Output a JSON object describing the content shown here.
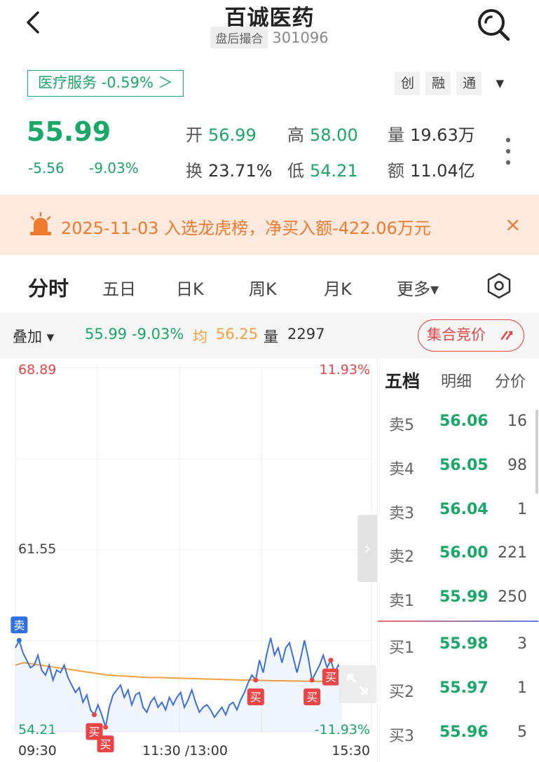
{
  "header": {
    "title": "百诚医药",
    "status": "盘后撮合",
    "code": "301096"
  },
  "sector": {
    "label": "医疗服务 -0.59% ＞"
  },
  "tags": [
    "创",
    "融",
    "通"
  ],
  "quote": {
    "price": "55.99",
    "change": "-5.56",
    "change_pct": "-9.03%",
    "open_label": "开",
    "open": "56.99",
    "high_label": "高",
    "high": "58.00",
    "volume_label": "量",
    "volume": "19.63万",
    "turnover_label": "换",
    "turnover": "23.71%",
    "low_label": "低",
    "low": "54.21",
    "amount_label": "额",
    "amount": "11.04亿"
  },
  "banner": {
    "text": "2025-11-03 入选龙虎榜，净买入额-422.06万元",
    "close": "×"
  },
  "tabs": {
    "items": [
      "分时",
      "五日",
      "日K",
      "周K",
      "月K",
      "更多▾"
    ]
  },
  "overlay": {
    "label": "叠加 ▾",
    "price": "55.99",
    "pct": "-9.03%",
    "avg_label": "均",
    "avg": "56.25",
    "vol_label": "量",
    "vol": "2297",
    "auction": "集合竞价"
  },
  "chart_data": {
    "type": "line",
    "y_top_left": "68.89",
    "y_mid_left": "61.55",
    "y_bottom_left": "54.21",
    "y_top_right": "11.93%",
    "y_bottom_right": "-11.93%",
    "x_labels": [
      "09:30",
      "11:30 /13:00",
      "15:30"
    ],
    "ylim": [
      54.21,
      68.89
    ],
    "series": [
      {
        "values": [
          57.6,
          57.9,
          57.4,
          57.1,
          56.8,
          56.9,
          57.3,
          56.7,
          56.5,
          56.9,
          56.3,
          56.7,
          56.6,
          56.9,
          56.4,
          56.1,
          55.8,
          56.0,
          55.4,
          55.7,
          55.1,
          54.9,
          55.3,
          54.9,
          54.4,
          55.2,
          55.7,
          55.9,
          56.1,
          55.6,
          55.9,
          55.3,
          55.7,
          55.8,
          55.2,
          55.0,
          55.4,
          55.6,
          55.2,
          55.4,
          55.1,
          55.6,
          55.3,
          55.6,
          55.8,
          55.2,
          55.5,
          55.9,
          55.4,
          55.0,
          55.2,
          55.3,
          55.1,
          54.8,
          55.0,
          55.2,
          54.9,
          55.3,
          55.4,
          55.1,
          55.5,
          55.8,
          56.2,
          56.5,
          56.3,
          57.1,
          56.6,
          57.4,
          58.0,
          57.3,
          57.6,
          57.0,
          57.6,
          57.8,
          57.2,
          56.6,
          57.2,
          57.9,
          57.2,
          56.3,
          56.6,
          56.9,
          57.3,
          56.8,
          57.1,
          56.6,
          56.9,
          56.5
        ]
      },
      {
        "values": [
          56.9,
          57.0,
          56.95,
          56.9,
          56.85,
          56.8,
          56.75,
          56.7,
          56.65,
          56.6,
          56.55,
          56.5,
          56.48,
          56.46,
          56.44,
          56.42,
          56.4,
          56.4,
          56.39,
          56.38,
          56.37,
          56.36,
          56.35,
          56.34,
          56.33,
          56.32,
          56.31,
          56.3,
          56.3,
          56.29,
          56.28,
          56.27,
          56.27,
          56.26,
          56.26,
          56.25,
          56.25,
          56.25,
          56.25,
          56.25
        ]
      }
    ],
    "sell_markers": [
      "卖"
    ],
    "buy_markers": [
      "买",
      "买",
      "买",
      "买",
      "买"
    ]
  },
  "orderbook": {
    "tabs": [
      "五档",
      "明细",
      "分价"
    ],
    "asks": [
      {
        "label": "卖5",
        "price": "56.06",
        "vol": "16"
      },
      {
        "label": "卖4",
        "price": "56.05",
        "vol": "98"
      },
      {
        "label": "卖3",
        "price": "56.04",
        "vol": "1"
      },
      {
        "label": "卖2",
        "price": "56.00",
        "vol": "221"
      },
      {
        "label": "卖1",
        "price": "55.99",
        "vol": "250"
      }
    ],
    "bids": [
      {
        "label": "买1",
        "price": "55.98",
        "vol": "3"
      },
      {
        "label": "买2",
        "price": "55.97",
        "vol": "1"
      },
      {
        "label": "买3",
        "price": "55.96",
        "vol": "5"
      }
    ]
  },
  "colors": {
    "down": "#19a867",
    "up": "#e94545",
    "avg_line": "#f5a03c",
    "price_line": "#3b6fe0",
    "banner": "#f07a2e"
  }
}
